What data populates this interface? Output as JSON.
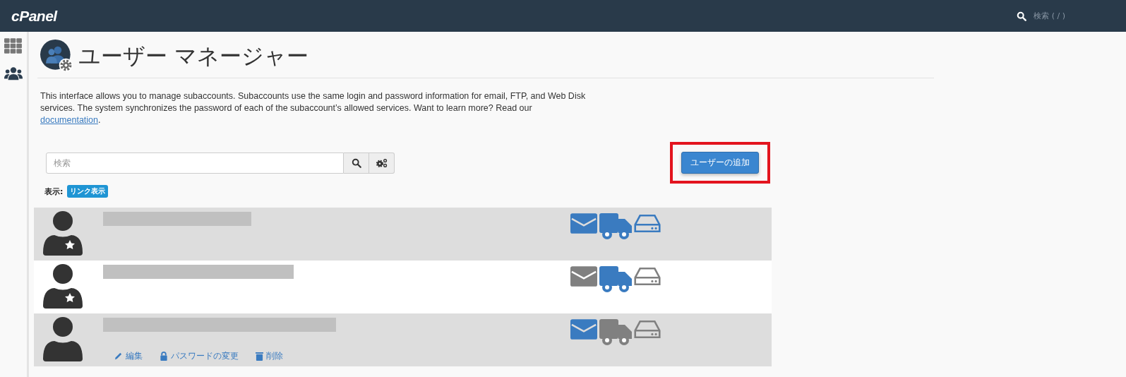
{
  "topbar": {
    "logo": "cPanel",
    "search_placeholder": "検索 ( / )"
  },
  "sidebar": {
    "items": [
      {
        "kind": "grid",
        "selected": false
      },
      {
        "kind": "users",
        "selected": true
      }
    ]
  },
  "page": {
    "title": "ユーザー マネージャー",
    "description": "This interface allows you to manage subaccounts. Subaccounts use the same login and password information for email, FTP, and Web Disk services. The system synchronizes the password of each of the subaccount’s allowed services. Want to learn more? Read our ",
    "link": "documentation",
    "after_link": "."
  },
  "search": {
    "placeholder": "検索"
  },
  "add_button": {
    "label": "ユーザーの追加",
    "highlighted": true
  },
  "view": {
    "label": "表示:",
    "badge": "リンク表示"
  },
  "users": [
    {
      "starred": true,
      "highlighted": true,
      "email": true,
      "ftp": true,
      "webdisk": true
    },
    {
      "starred": true,
      "highlighted": false,
      "email": false,
      "ftp": true,
      "webdisk": false
    },
    {
      "starred": false,
      "highlighted": true,
      "email": true,
      "ftp": false,
      "webdisk": false,
      "actions": [
        {
          "kind": "edit",
          "label": "編集"
        },
        {
          "kind": "password",
          "label": "パスワードの変更"
        },
        {
          "kind": "delete",
          "label": "削除"
        }
      ]
    }
  ]
}
